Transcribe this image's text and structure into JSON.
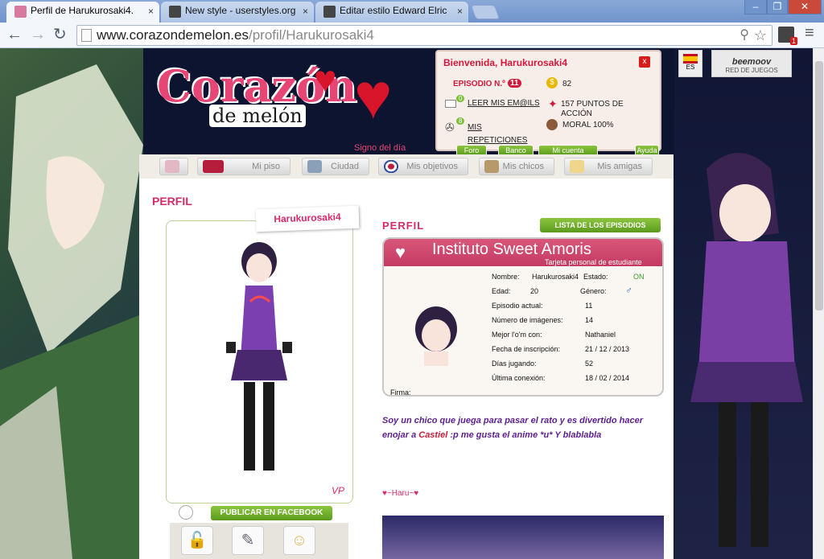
{
  "tabs": [
    {
      "title": "Perfil de Harukurosaki4.",
      "close": "×"
    },
    {
      "title": "New style - userstyles.org",
      "close": "×"
    },
    {
      "title": "Editar estilo Edward Elric",
      "close": "×"
    }
  ],
  "window_controls": {
    "minimize": "–",
    "restore": "❐",
    "close": "✕"
  },
  "toolbar": {
    "back": "←",
    "forward": "→",
    "reload": "↻",
    "url_host": "www.corazondemelon.es",
    "url_path": "/profil/Harukurosaki4",
    "search_icon": "⚲",
    "star_icon": "☆",
    "menu_icon": "≡",
    "ext_badge": "1"
  },
  "logo": {
    "word1": "Corazón",
    "word2": "de melón",
    "sign": "Signo del día"
  },
  "welcome": {
    "title": "Bienvenida, Harukurosaki4",
    "close": "x",
    "episode_label": "EPISODIO N.º",
    "episode_number": "11",
    "coins": "82",
    "mails_count": "0",
    "mails_link": "LEER MIS EM@ILS",
    "action_points": "157 PUNTOS DE ACCIÓN",
    "replays_count": "8",
    "replays_link": "MIS REPETICIONES",
    "moral": "MORAL 100%",
    "buttons": [
      "Foro",
      "Banco",
      "Mi cuenta",
      "Ayuda"
    ]
  },
  "lang": "ES",
  "beemoov": {
    "name": "beemoov",
    "label": "RED DE JUEGOS"
  },
  "nav": [
    "Mi piso",
    "Ciudad",
    "Mis objetivos",
    "Mis chicos",
    "Mis amigas"
  ],
  "profile": {
    "left_title": "PERFIL",
    "username": "Harukurosaki4",
    "fb_button": "PUBLICAR EN FACEBOOK",
    "right_title": "PERFIL",
    "episodes_button": "LISTA DE LOS EPISODIOS"
  },
  "idcard": {
    "school": "Instituto Sweet Amoris",
    "subtitle": "Tarjeta personal de estudiante",
    "rows": [
      {
        "label": "Nombre:",
        "value": "Harukurosaki4"
      },
      {
        "label": "Edad:",
        "value": "20"
      },
      {
        "label": "Episodio actual:",
        "value": "11"
      },
      {
        "label": "Número de imágenes:",
        "value": "14"
      },
      {
        "label": "Mejor l'o'm con:",
        "value": "Nathaniel"
      },
      {
        "label": "Fecha de inscripción:",
        "value": "21 / 12 / 2013"
      },
      {
        "label": "Días jugando:",
        "value": "52"
      },
      {
        "label": "Última conexión:",
        "value": "18 / 02 / 2014"
      }
    ],
    "estado_label": "Estado:",
    "estado_value": "ON",
    "genero_label": "Género:",
    "firma": "Firma:"
  },
  "bio": {
    "part1": "Soy un chico que juega para pasar el rato y es divertido hacer enojar a ",
    "highlight": "Castiel",
    "part2": " :p me gusta el anime *u* Y blablabla"
  },
  "signature": "♥~Haru~♥",
  "colors": {
    "accent": "#d62a6b",
    "green": "#6aaa24",
    "red": "#d2193c"
  }
}
